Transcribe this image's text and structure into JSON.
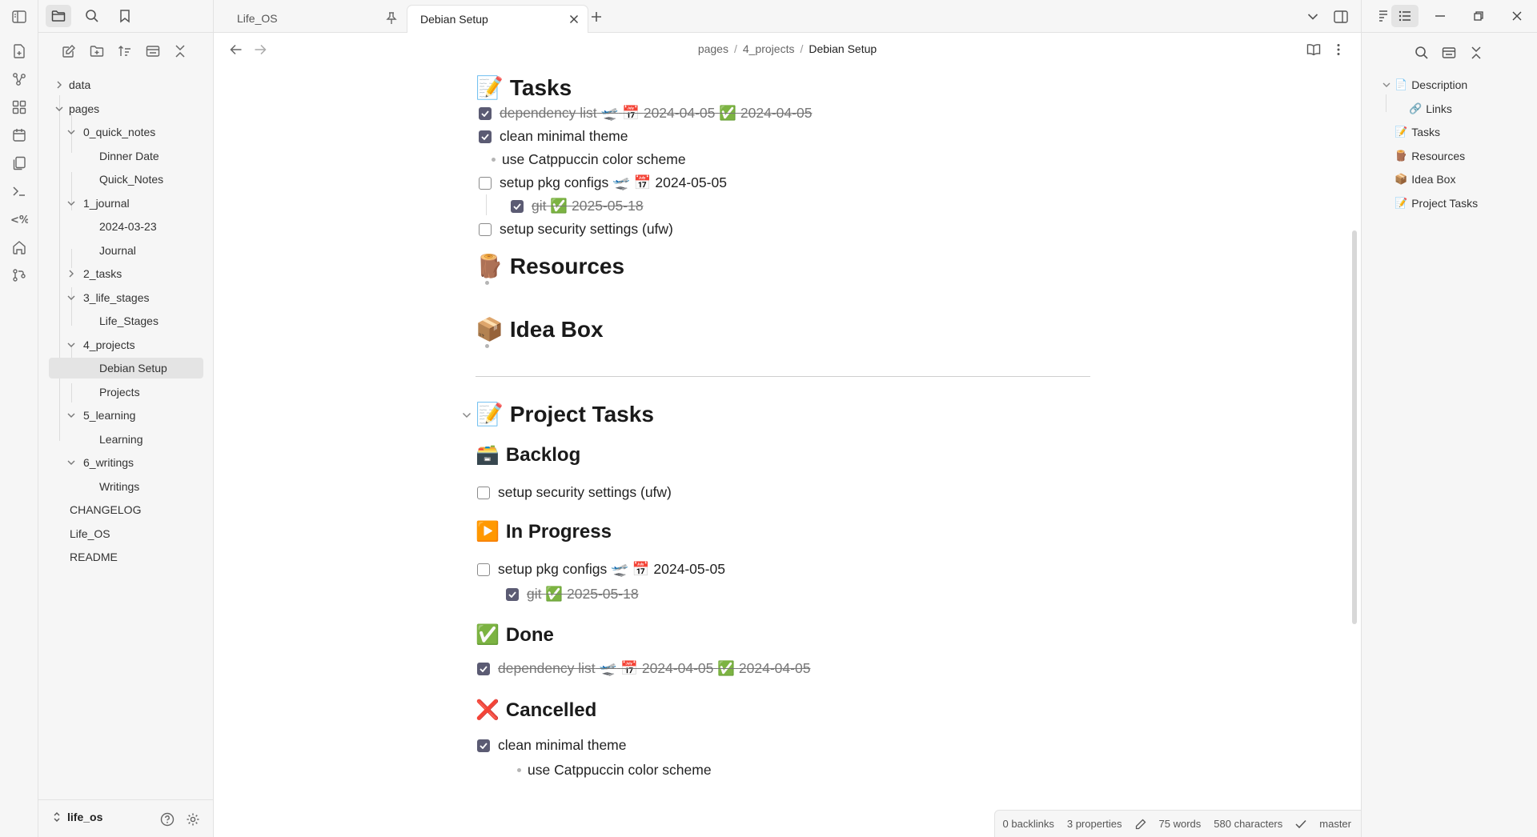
{
  "ribbon": {
    "icons": [
      "new-note-icon",
      "graph-view-icon",
      "canvas-icon",
      "daily-note-icon",
      "templates-icon",
      "terminal-icon",
      "templater-icon",
      "homepage-icon",
      "git-icon"
    ]
  },
  "left_sidebar": {
    "tree": [
      {
        "label": "data",
        "depth": 0,
        "type": "folder",
        "expanded": false
      },
      {
        "label": "pages",
        "depth": 0,
        "type": "folder",
        "expanded": true
      },
      {
        "label": "0_quick_notes",
        "depth": 1,
        "type": "folder",
        "expanded": true
      },
      {
        "label": "Dinner Date",
        "depth": 2,
        "type": "file"
      },
      {
        "label": "Quick_Notes",
        "depth": 2,
        "type": "file"
      },
      {
        "label": "1_journal",
        "depth": 1,
        "type": "folder",
        "expanded": true
      },
      {
        "label": "2024-03-23",
        "depth": 2,
        "type": "file"
      },
      {
        "label": "Journal",
        "depth": 2,
        "type": "file"
      },
      {
        "label": "2_tasks",
        "depth": 1,
        "type": "folder",
        "expanded": false
      },
      {
        "label": "3_life_stages",
        "depth": 1,
        "type": "folder",
        "expanded": true
      },
      {
        "label": "Life_Stages",
        "depth": 2,
        "type": "file"
      },
      {
        "label": "4_projects",
        "depth": 1,
        "type": "folder",
        "expanded": true
      },
      {
        "label": "Debian Setup",
        "depth": 2,
        "type": "file",
        "active": true
      },
      {
        "label": "Projects",
        "depth": 2,
        "type": "file"
      },
      {
        "label": "5_learning",
        "depth": 1,
        "type": "folder",
        "expanded": true
      },
      {
        "label": "Learning",
        "depth": 2,
        "type": "file"
      },
      {
        "label": "6_writings",
        "depth": 1,
        "type": "folder",
        "expanded": true
      },
      {
        "label": "Writings",
        "depth": 2,
        "type": "file"
      },
      {
        "label": "CHANGELOG",
        "depth": 0,
        "type": "file"
      },
      {
        "label": "Life_OS",
        "depth": 0,
        "type": "file"
      },
      {
        "label": "README",
        "depth": 0,
        "type": "file"
      }
    ],
    "vault_name": "life_os"
  },
  "tabs": [
    {
      "title": "Life_OS",
      "pinned": true,
      "active": false
    },
    {
      "title": "Debian Setup",
      "pinned": false,
      "active": true
    }
  ],
  "breadcrumb": {
    "parts": [
      "pages",
      "4_projects"
    ],
    "current": "Debian Setup"
  },
  "document": {
    "tasks_heading": {
      "emoji": "📝",
      "text": "Tasks"
    },
    "task_lines": [
      {
        "text": "dependency list",
        "emojis": [
          "🛫",
          "📅"
        ],
        "date": "2024-04-05",
        "done_emoji": "✅",
        "done_date": "2024-04-05"
      },
      {
        "text": "clean minimal theme"
      },
      {
        "text": "use Catppuccin color scheme"
      },
      {
        "text": "setup pkg configs",
        "emojis": [
          "🛫",
          "📅"
        ],
        "date": "2024-05-05"
      },
      {
        "text": "git",
        "done_emoji": "✅",
        "done_date": "2025-05-18"
      },
      {
        "text": "setup security settings (ufw)"
      }
    ],
    "resources_heading": {
      "emoji": "🪵",
      "text": "Resources"
    },
    "ideabox_heading": {
      "emoji": "📦",
      "text": "Idea Box"
    },
    "project_tasks_heading": {
      "emoji": "📝",
      "text": "Project Tasks"
    },
    "backlog_heading": {
      "emoji": "🗃️",
      "text": "Backlog"
    },
    "backlog_items": [
      {
        "text": "setup security settings (ufw)"
      }
    ],
    "inprogress_heading": {
      "emoji": "▶️",
      "text": "In Progress"
    },
    "inprogress_items": [
      {
        "text": "setup pkg configs",
        "emojis": [
          "🛫",
          "📅"
        ],
        "date": "2024-05-05"
      },
      {
        "text": "git",
        "done_emoji": "✅",
        "done_date": "2025-05-18"
      }
    ],
    "done_heading": {
      "emoji": "✅",
      "text": "Done"
    },
    "done_items": [
      {
        "text": "dependency list",
        "emojis": [
          "🛫",
          "📅"
        ],
        "date": "2024-04-05",
        "done_emoji": "✅",
        "done_date": "2024-04-05"
      }
    ],
    "cancelled_heading": {
      "emoji": "❌",
      "text": "Cancelled"
    },
    "cancelled_items": [
      {
        "text": "clean minimal theme"
      },
      {
        "text": "use Catppuccin color scheme"
      }
    ]
  },
  "status_bar": {
    "backlinks": "0 backlinks",
    "properties": "3 properties",
    "words": "75 words",
    "characters": "580 characters",
    "branch": "master"
  },
  "outline": [
    {
      "emoji": "📄",
      "label": "Description",
      "depth": 0,
      "expanded": true
    },
    {
      "emoji": "🔗",
      "label": "Links",
      "depth": 1
    },
    {
      "emoji": "📝",
      "label": "Tasks",
      "depth": 0
    },
    {
      "emoji": "🪵",
      "label": "Resources",
      "depth": 0
    },
    {
      "emoji": "📦",
      "label": "Idea Box",
      "depth": 0
    },
    {
      "emoji": "📝",
      "label": "Project Tasks",
      "depth": 0
    }
  ],
  "colors": {
    "accent": "#5b5b73",
    "sidebar_bg": "#f6f6f6",
    "border": "#e2e2e2"
  }
}
